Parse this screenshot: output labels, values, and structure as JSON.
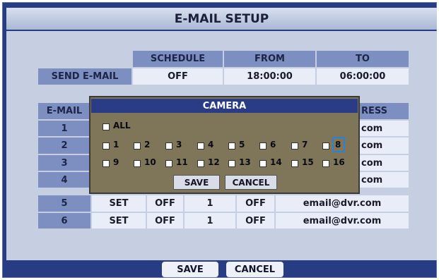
{
  "title": "E-MAIL SETUP",
  "schedule_table": {
    "headers": [
      "SCHEDULE",
      "FROM",
      "TO"
    ],
    "row_label": "SEND E-MAIL",
    "values": [
      "OFF",
      "18:00:00",
      "06:00:00"
    ]
  },
  "email_table": {
    "headers": [
      "E-MAIL",
      "RESS"
    ],
    "rows": [
      {
        "num": "1",
        "tail": "com"
      },
      {
        "num": "2",
        "tail": "com"
      },
      {
        "num": "3",
        "tail": "com"
      },
      {
        "num": "4",
        "tail": "com"
      },
      {
        "num": "5",
        "set": "SET",
        "a": "OFF",
        "b": "1",
        "c": "OFF",
        "addr": "email@dvr.com"
      },
      {
        "num": "6",
        "set": "SET",
        "a": "OFF",
        "b": "1",
        "c": "OFF",
        "addr": "email@dvr.com"
      }
    ]
  },
  "camera_popup": {
    "title": "CAMERA",
    "all_label": "ALL",
    "cameras": [
      "1",
      "2",
      "3",
      "4",
      "5",
      "6",
      "7",
      "8",
      "9",
      "10",
      "11",
      "12",
      "13",
      "14",
      "15",
      "16"
    ],
    "focused_camera": "8",
    "save_label": "SAVE",
    "cancel_label": "CANCEL"
  },
  "footer": {
    "save_label": "SAVE",
    "cancel_label": "CANCEL"
  },
  "colors": {
    "screen_bg": "#283c84",
    "header_cell": "#7d8ec0",
    "value_cell": "#e9edf7",
    "popup_bg": "#7f7558",
    "popup_title": "#2a3c86",
    "focus": "#2e7fd8"
  }
}
